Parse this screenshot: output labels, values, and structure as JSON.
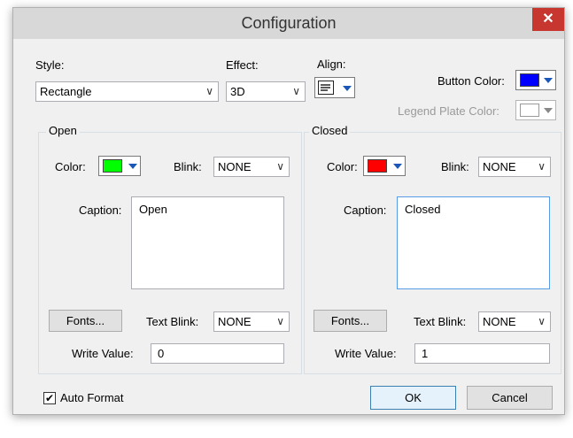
{
  "window": {
    "title": "Configuration",
    "close_glyph": "✕"
  },
  "style": {
    "label": "Style:",
    "value": "Rectangle"
  },
  "effect": {
    "label": "Effect:",
    "value": "3D"
  },
  "align": {
    "label": "Align:",
    "icon": "align-left-icon"
  },
  "button_color": {
    "label": "Button Color:",
    "color": "#0000ff"
  },
  "legend_plate_color": {
    "label": "Legend Plate Color:",
    "color": "#ffffff"
  },
  "open": {
    "group_label": "Open",
    "color_label": "Color:",
    "color": "#00ff00",
    "blink_label": "Blink:",
    "blink_value": "NONE",
    "caption_label": "Caption:",
    "caption_value": "Open",
    "fonts_label": "Fonts...",
    "text_blink_label": "Text Blink:",
    "text_blink_value": "NONE",
    "write_value_label": "Write Value:",
    "write_value": "0"
  },
  "closed": {
    "group_label": "Closed",
    "color_label": "Color:",
    "color": "#ff0000",
    "blink_label": "Blink:",
    "blink_value": "NONE",
    "caption_label": "Caption:",
    "caption_value": "Closed",
    "fonts_label": "Fonts...",
    "text_blink_label": "Text Blink:",
    "text_blink_value": "NONE",
    "write_value_label": "Write Value:",
    "write_value": "1"
  },
  "auto_format": {
    "label": "Auto Format",
    "checked": true,
    "check_glyph": "✔"
  },
  "footer": {
    "ok_label": "OK",
    "cancel_label": "Cancel"
  },
  "chevron": "∨"
}
